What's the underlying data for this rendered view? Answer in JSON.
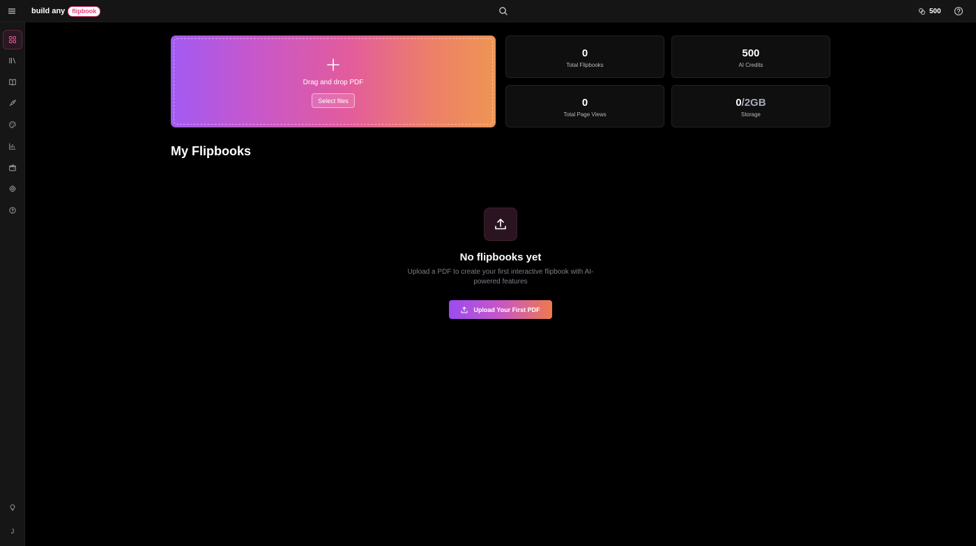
{
  "header": {
    "logo_text": "build any",
    "logo_badge": "flipbook",
    "credits": "500"
  },
  "sidebar": {
    "items": [
      {
        "icon": "grid-icon",
        "active": true
      },
      {
        "icon": "library-icon"
      },
      {
        "icon": "book-open-icon"
      },
      {
        "icon": "rocket-icon"
      },
      {
        "icon": "palette-icon"
      },
      {
        "icon": "bar-chart-icon"
      },
      {
        "icon": "wallet-icon"
      },
      {
        "icon": "settings-icon"
      },
      {
        "icon": "help-circle-icon"
      }
    ],
    "bottom": {
      "icon": "lightbulb-icon",
      "avatar_initial": "J"
    }
  },
  "upload": {
    "drop_label": "Drag and drop PDF",
    "select_button": "Select files"
  },
  "stats": {
    "total_flipbooks": {
      "value": "0",
      "label": "Total Flipbooks"
    },
    "ai_credits": {
      "value": "500",
      "label": "AI Credits"
    },
    "page_views": {
      "value": "0",
      "label": "Total Page Views"
    },
    "storage": {
      "used": "0",
      "total": "/2GB",
      "label": "Storage"
    }
  },
  "flipbooks": {
    "title": "My Flipbooks",
    "empty_title": "No flipbooks yet",
    "empty_text": "Upload a PDF to create your first interactive flipbook with AI-powered features",
    "cta_label": "Upload Your First PDF"
  },
  "colors": {
    "gradient_start": "#a25af3",
    "gradient_mid": "#e35c9c",
    "gradient_end": "#ee9553"
  }
}
